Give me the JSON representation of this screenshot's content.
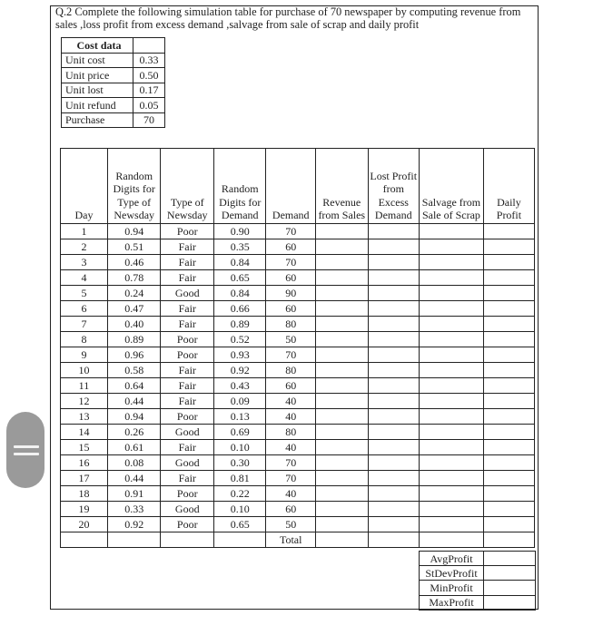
{
  "question": "Q.2 Complete the following simulation table for purchase of 70 newspaper by computing revenue from sales ,loss profit from excess demand ,salvage from sale of scrap and daily profit",
  "cost_data": {
    "title": "Cost data",
    "rows": [
      {
        "label": "Unit cost",
        "value": "0.33"
      },
      {
        "label": "Unit price",
        "value": "0.50"
      },
      {
        "label": "Unit lost",
        "value": "0.17"
      },
      {
        "label": "Unit refund",
        "value": "0.05"
      }
    ],
    "purchase": {
      "label": "Purchase",
      "value": "70"
    }
  },
  "simulation": {
    "headers": [
      "Day",
      "Random Digits for Type of Newsday",
      "Type of Newsday",
      "Random Digits for Demand",
      "Demand",
      "Revenue from Sales",
      "Lost Profit from Excess Demand",
      "Salvage from Sale of Scrap",
      "Daily Profit"
    ],
    "rows": [
      {
        "day": "1",
        "rd_type": "0.94",
        "type": "Poor",
        "rd_demand": "0.90",
        "demand": "70"
      },
      {
        "day": "2",
        "rd_type": "0.51",
        "type": "Fair",
        "rd_demand": "0.35",
        "demand": "60"
      },
      {
        "day": "3",
        "rd_type": "0.46",
        "type": "Fair",
        "rd_demand": "0.84",
        "demand": "70"
      },
      {
        "day": "4",
        "rd_type": "0.78",
        "type": "Fair",
        "rd_demand": "0.65",
        "demand": "60"
      },
      {
        "day": "5",
        "rd_type": "0.24",
        "type": "Good",
        "rd_demand": "0.84",
        "demand": "90"
      },
      {
        "day": "6",
        "rd_type": "0.47",
        "type": "Fair",
        "rd_demand": "0.66",
        "demand": "60"
      },
      {
        "day": "7",
        "rd_type": "0.40",
        "type": "Fair",
        "rd_demand": "0.89",
        "demand": "80"
      },
      {
        "day": "8",
        "rd_type": "0.89",
        "type": "Poor",
        "rd_demand": "0.52",
        "demand": "50"
      },
      {
        "day": "9",
        "rd_type": "0.96",
        "type": "Poor",
        "rd_demand": "0.93",
        "demand": "70"
      },
      {
        "day": "10",
        "rd_type": "0.58",
        "type": "Fair",
        "rd_demand": "0.92",
        "demand": "80"
      },
      {
        "day": "11",
        "rd_type": "0.64",
        "type": "Fair",
        "rd_demand": "0.43",
        "demand": "60"
      },
      {
        "day": "12",
        "rd_type": "0.44",
        "type": "Fair",
        "rd_demand": "0.09",
        "demand": "40"
      },
      {
        "day": "13",
        "rd_type": "0.94",
        "type": "Poor",
        "rd_demand": "0.13",
        "demand": "40"
      },
      {
        "day": "14",
        "rd_type": "0.26",
        "type": "Good",
        "rd_demand": "0.69",
        "demand": "80"
      },
      {
        "day": "15",
        "rd_type": "0.61",
        "type": "Fair",
        "rd_demand": "0.10",
        "demand": "40"
      },
      {
        "day": "16",
        "rd_type": "0.08",
        "type": "Good",
        "rd_demand": "0.30",
        "demand": "70"
      },
      {
        "day": "17",
        "rd_type": "0.44",
        "type": "Fair",
        "rd_demand": "0.81",
        "demand": "70"
      },
      {
        "day": "18",
        "rd_type": "0.91",
        "type": "Poor",
        "rd_demand": "0.22",
        "demand": "40"
      },
      {
        "day": "19",
        "rd_type": "0.33",
        "type": "Good",
        "rd_demand": "0.10",
        "demand": "60"
      },
      {
        "day": "20",
        "rd_type": "0.92",
        "type": "Poor",
        "rd_demand": "0.65",
        "demand": "50"
      }
    ],
    "total_label": "Total"
  },
  "stats": [
    "AvgProfit",
    "StDevProfit",
    "MinProfit",
    "MaxProfit"
  ],
  "side_handle": {
    "icon": "drag-handle-icon"
  }
}
